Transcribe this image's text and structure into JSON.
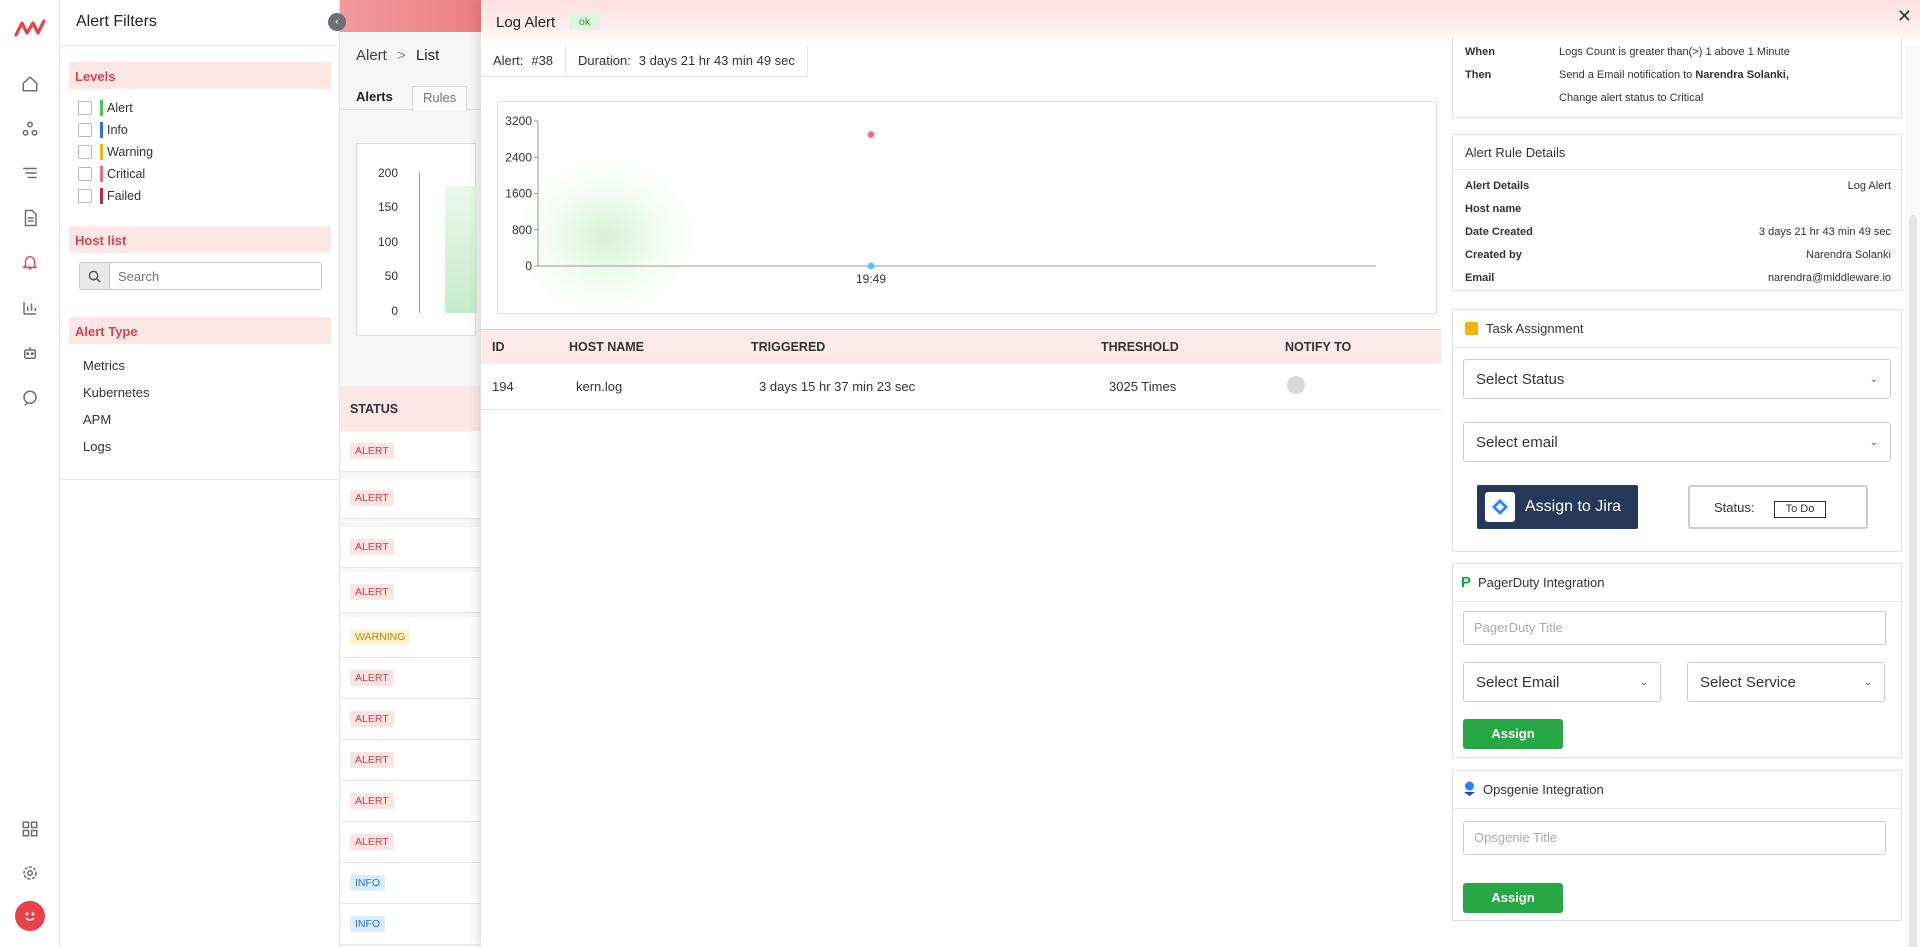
{
  "filters": {
    "title": "Alert Filters",
    "levels_heading": "Levels",
    "levels": [
      {
        "label": "Alert",
        "color": "#3ecb5b"
      },
      {
        "label": "Info",
        "color": "#2f6fe6"
      },
      {
        "label": "Warning",
        "color": "#f5b400"
      },
      {
        "label": "Critical",
        "color": "#ef6a74"
      },
      {
        "label": "Failed",
        "color": "#c9283a"
      }
    ],
    "host_heading": "Host list",
    "search_placeholder": "Search",
    "type_heading": "Alert Type",
    "types": [
      "Metrics",
      "Kubernetes",
      "APM",
      "Logs"
    ]
  },
  "list": {
    "breadcrumb_root": "Alert",
    "breadcrumb_sep": ">",
    "breadcrumb_leaf": "List",
    "tabs": [
      "Alerts",
      "Rules"
    ],
    "y_ticks": [
      "200",
      "150",
      "100",
      "50",
      "0"
    ],
    "status_header": "STATUS",
    "rows": [
      "ALERT",
      "ALERT",
      "ALERT",
      "ALERT",
      "WARNING",
      "ALERT",
      "ALERT",
      "ALERT",
      "ALERT",
      "ALERT",
      "INFO",
      "INFO"
    ]
  },
  "modal": {
    "title": "Log Alert",
    "status_badge": "ok",
    "alert_label": "Alert:",
    "alert_id": "#38",
    "duration_label": "Duration:",
    "duration_value": "3 days 21 hr 43 min 49 sec",
    "table": {
      "headers": [
        "ID",
        "HOST NAME",
        "TRIGGERED",
        "THRESHOLD",
        "NOTIFY TO"
      ],
      "rows": [
        {
          "id": "194",
          "host": "kern.log",
          "triggered": "3 days 15 hr 37 min 23 sec",
          "threshold": "3025 Times"
        }
      ]
    }
  },
  "chart_data": {
    "type": "scatter",
    "y_ticks": [
      "3200",
      "2400",
      "1600",
      "800",
      "0"
    ],
    "ylim": [
      0,
      3200
    ],
    "x_tick": "19:49",
    "series": [
      {
        "points": [
          {
            "x": "19:49",
            "y": 2900
          }
        ],
        "color": "#e57373"
      },
      {
        "points": [
          {
            "x": "19:49",
            "y": 0
          }
        ],
        "color": "#4fc3f7"
      }
    ]
  },
  "rule": {
    "when_label": "When",
    "when_text": "Logs Count is greater than(>) 1 above 1 Minute",
    "then_label": "Then",
    "then_text_prefix": "Send a Email notification to ",
    "then_text_bold": "Narendra Solanki,",
    "then_text_2": "Change alert status to Critical"
  },
  "details": {
    "title": "Alert Rule Details",
    "rows": [
      {
        "label": "Alert Details",
        "value": "Log Alert"
      },
      {
        "label": "Host name",
        "value": ""
      },
      {
        "label": "Date Created",
        "value": "3 days 21 hr 43 min 49 sec"
      },
      {
        "label": "Created by",
        "value": "Narendra Solanki"
      },
      {
        "label": "Email",
        "value": "narendra@middleware.io"
      }
    ]
  },
  "task": {
    "title": "Task Assignment",
    "status_select": "Select Status",
    "email_select": "Select email",
    "jira_button": "Assign to Jira",
    "status_label": "Status:",
    "status_value": "To Do"
  },
  "pagerduty": {
    "title": "PagerDuty Integration",
    "title_placeholder": "PagerDuty Title",
    "email_select": "Select Email",
    "service_select": "Select Service",
    "assign": "Assign"
  },
  "opsgenie": {
    "title": "Opsgenie Integration",
    "title_placeholder": "Opsgenie Title",
    "assign": "Assign"
  }
}
